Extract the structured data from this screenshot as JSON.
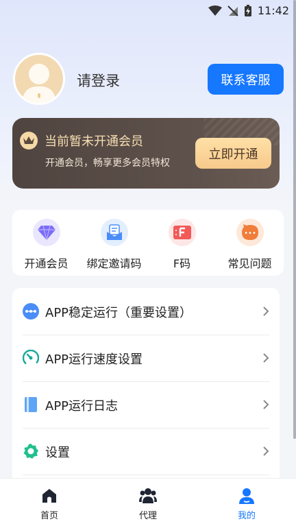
{
  "status_bar": {
    "time": "11:42"
  },
  "profile": {
    "login_text": "请登录",
    "contact_button": "联系客服"
  },
  "vip": {
    "title": "当前暂未开通会员",
    "subtitle": "开通会员，畅享更多会员特权",
    "button": "立即开通"
  },
  "quick_actions": [
    {
      "label": "开通会员",
      "icon": "diamond-icon",
      "color": "#7b6cf6"
    },
    {
      "label": "绑定邀请码",
      "icon": "invite-mail-icon",
      "color": "#4a8df8"
    },
    {
      "label": "F码",
      "icon": "f-code-icon",
      "color": "#f25a5a"
    },
    {
      "label": "常见问题",
      "icon": "faq-icon",
      "color": "#f07d3a"
    }
  ],
  "settings": [
    {
      "label": "APP稳定运行（重要设置）",
      "icon": "stable-run-icon"
    },
    {
      "label": "APP运行速度设置",
      "icon": "speed-gauge-icon"
    },
    {
      "label": "APP运行日志",
      "icon": "log-book-icon"
    },
    {
      "label": "设置",
      "icon": "gear-icon"
    }
  ],
  "nav": [
    {
      "label": "首页",
      "icon": "home-icon"
    },
    {
      "label": "代理",
      "icon": "agent-group-icon"
    },
    {
      "label": "我的",
      "icon": "profile-icon",
      "active": true
    }
  ],
  "colors": {
    "accent": "#1677ff",
    "vip_gold": "#f7dfb2"
  }
}
